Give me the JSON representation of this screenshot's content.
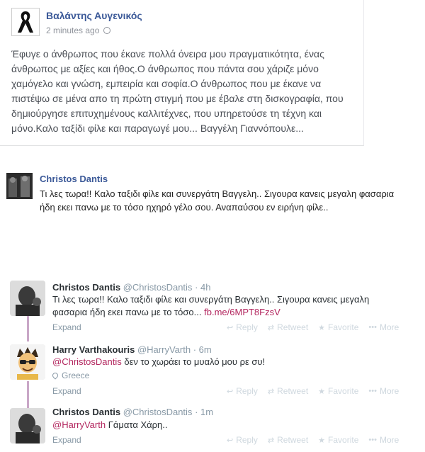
{
  "fb_post": {
    "author": "Βαλάντης Αυγενικός",
    "time": "2 minutes ago",
    "text": "Έφυγε ο άνθρωπος που έκανε πολλά όνειρα μου πραγματικότητα, ένας άνθρωπος με αξίες και ήθος.Ο άνθρωπος που πάντα σου χάριζε μόνο χαμόγελο και γνώση, εμπειρία και σοφία.Ο άνθρωπος που με έκανε να πιστέψω σε μένα απο τη πρώτη στιγμή που με έβαλε στη δισκογραφία, που δημιούργησε επιτυχημένους καλλιτέχνες, που υπηρετούσε τη τέχνη και μόνο.Καλο ταξίδι φίλε και παραγωγέ μου... Βαγγέλη Γιαννόπουλε..."
  },
  "fb_comment": {
    "author": "Christos Dantis",
    "text": "Τι λες τωρα!! Καλο ταξιδι φίλε και συνεργάτη Βαγγελη.. Σιγουρα κανεις μεγαλη φασαρια ήδη εκει πανω με το τόσο ηχηρό γέλο σου. Αναπαύσου εν ειρήνη φίλε.."
  },
  "tweets": [
    {
      "name": "Christos Dantis",
      "handle": "@ChristosDantis",
      "time": "· 4h",
      "text": "Τι λες τωρα!! Καλο ταξιδι φίλε και συνεργάτη Βαγγελη.. Σιγουρα κανεις μεγαλη φασαρια ήδη εκει πανω με το τόσο...",
      "link": "fb.me/6MPT8FzsV"
    },
    {
      "name": "Harry Varthakouris",
      "handle": "@HarryVarth",
      "time": "· 6m",
      "mention": "@ChristosDantis",
      "text": " δεν το χωράει το μυαλό μου ρε συ!",
      "location": "Greece"
    },
    {
      "name": "Christos Dantis",
      "handle": "@ChristosDantis",
      "time": "· 1m",
      "mention": "@HarryVarth",
      "text": " Γάματα Χάρη.."
    }
  ],
  "tweet_actions": {
    "expand": "Expand",
    "reply": "Reply",
    "retweet": "Retweet",
    "favorite": "Favorite",
    "more": "More"
  },
  "icons": {
    "fb_avatar": "black-ribbon-icon",
    "privacy": "globe-icon",
    "location": "map-pin-icon",
    "reply": "reply-icon",
    "retweet": "retweet-icon",
    "favorite": "star-icon",
    "more": "ellipsis-icon"
  },
  "colors": {
    "fb_link": "#3b5998",
    "tw_link": "#b3275f",
    "muted": "#8899a6"
  }
}
